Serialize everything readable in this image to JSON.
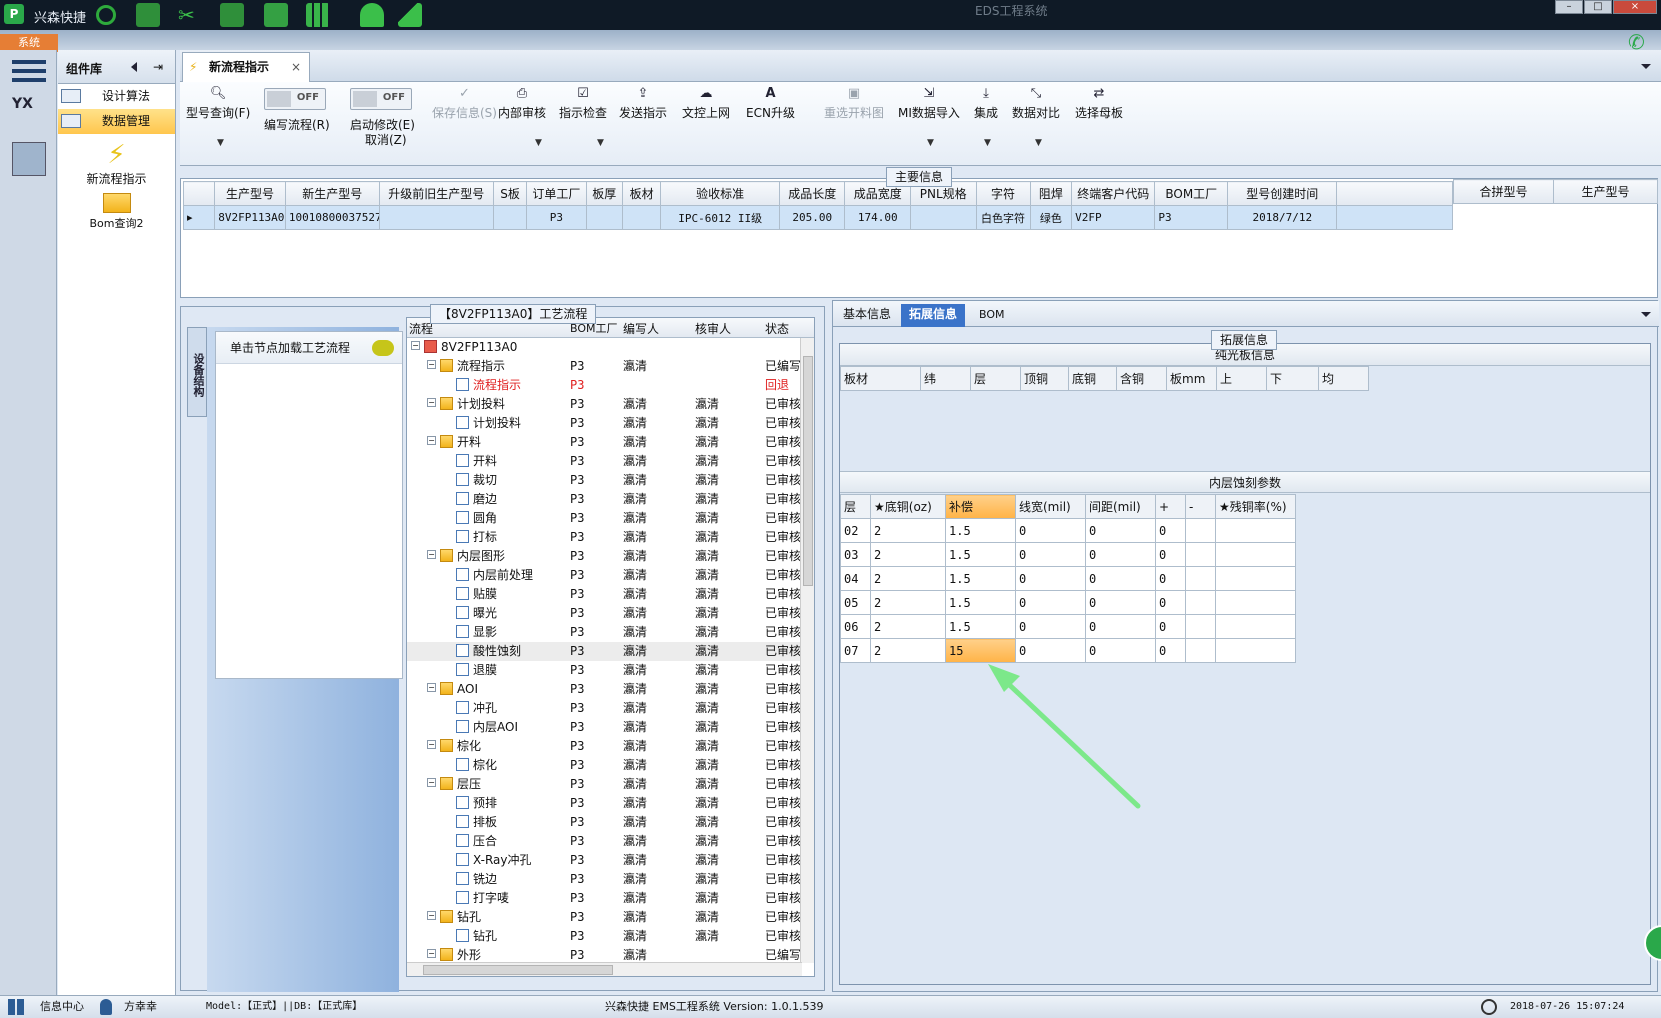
{
  "titlebar": {
    "app_name": "兴森快捷",
    "window_title": "EDS工程系统"
  },
  "system_tab": "系统",
  "component_panel": {
    "title": "组件库",
    "items": [
      {
        "label": "设计算法"
      },
      {
        "label": "数据管理"
      }
    ],
    "big_items": [
      {
        "label": "新流程指示"
      },
      {
        "label": "Bom查询2"
      }
    ]
  },
  "doc_tab": {
    "label": "新流程指示",
    "close": "×"
  },
  "toolbar": {
    "model_query": "型号查询(F)",
    "edit_flow": "编写流程(R)",
    "start_edit": "启动修改(E)",
    "cancel": "取消(Z)",
    "toggle_off": "OFF",
    "save_info": "保存信息(S)",
    "internal_review": "内部审核",
    "instruction_check": "指示检查",
    "send_instruction": "发送指示",
    "upload": "文控上网",
    "ecn_upgrade": "ECN升级",
    "reselect_cut": "重选开料图",
    "mi_import": "MI数据导入",
    "integrate": "集成",
    "data_compare": "数据对比",
    "select_master": "选择母板"
  },
  "main_info": {
    "title": "主要信息",
    "columns": [
      "生产型号",
      "新生产型号",
      "升级前旧生产型号",
      "S板",
      "订单工厂",
      "板厚",
      "板材",
      "验收标准",
      "成品长度",
      "成品宽度",
      "PNL规格",
      "字符",
      "阻焊",
      "终端客户代码",
      "BOM工厂",
      "型号创建时间"
    ],
    "row": [
      "8V2FP113A0",
      "10010800037527",
      "",
      "",
      "P3",
      "",
      "",
      "IPC-6012 II级",
      "205.00",
      "174.00",
      "",
      "白色字符",
      "绿色",
      "V2FP",
      "P3",
      "2018/7/12"
    ],
    "side_columns": [
      "合拼型号",
      "生产型号"
    ]
  },
  "flow_panel": {
    "title": "【8V2FP113A0】工艺流程",
    "vertical_tab": "设备结构",
    "leaf_prompt": "单击节点加载工艺流程",
    "columns": [
      "流程",
      "BOM工厂",
      "编写人",
      "核审人",
      "状态"
    ],
    "rows": [
      {
        "level": 0,
        "type": "home",
        "exp": "−",
        "name": "8V2FP113A0",
        "bom": "",
        "writer": "",
        "reviewer": "",
        "status": ""
      },
      {
        "level": 1,
        "type": "folder",
        "exp": "−",
        "name": "流程指示",
        "bom": "P3",
        "writer": "瀛清",
        "reviewer": "",
        "status": "已编写"
      },
      {
        "level": 2,
        "type": "doc",
        "name": "流程指示",
        "bom": "P3",
        "writer": "",
        "reviewer": "",
        "status": "回退",
        "red": true
      },
      {
        "level": 1,
        "type": "folder",
        "exp": "−",
        "name": "计划投料",
        "bom": "P3",
        "writer": "瀛清",
        "reviewer": "瀛清",
        "status": "已审核"
      },
      {
        "level": 2,
        "type": "doc",
        "name": "计划投料",
        "bom": "P3",
        "writer": "瀛清",
        "reviewer": "瀛清",
        "status": "已审核"
      },
      {
        "level": 1,
        "type": "folder",
        "exp": "−",
        "name": "开料",
        "bom": "P3",
        "writer": "瀛清",
        "reviewer": "瀛清",
        "status": "已审核"
      },
      {
        "level": 2,
        "type": "doc",
        "name": "开料",
        "bom": "P3",
        "writer": "瀛清",
        "reviewer": "瀛清",
        "status": "已审核"
      },
      {
        "level": 2,
        "type": "doc",
        "name": "裁切",
        "bom": "P3",
        "writer": "瀛清",
        "reviewer": "瀛清",
        "status": "已审核"
      },
      {
        "level": 2,
        "type": "doc",
        "name": "磨边",
        "bom": "P3",
        "writer": "瀛清",
        "reviewer": "瀛清",
        "status": "已审核"
      },
      {
        "level": 2,
        "type": "doc",
        "name": "圆角",
        "bom": "P3",
        "writer": "瀛清",
        "reviewer": "瀛清",
        "status": "已审核"
      },
      {
        "level": 2,
        "type": "doc",
        "name": "打标",
        "bom": "P3",
        "writer": "瀛清",
        "reviewer": "瀛清",
        "status": "已审核"
      },
      {
        "level": 1,
        "type": "folder",
        "exp": "−",
        "name": "内层图形",
        "bom": "P3",
        "writer": "瀛清",
        "reviewer": "瀛清",
        "status": "已审核"
      },
      {
        "level": 2,
        "type": "doc",
        "name": "内层前处理",
        "bom": "P3",
        "writer": "瀛清",
        "reviewer": "瀛清",
        "status": "已审核"
      },
      {
        "level": 2,
        "type": "doc",
        "name": "贴膜",
        "bom": "P3",
        "writer": "瀛清",
        "reviewer": "瀛清",
        "status": "已审核"
      },
      {
        "level": 2,
        "type": "doc",
        "name": "曝光",
        "bom": "P3",
        "writer": "瀛清",
        "reviewer": "瀛清",
        "status": "已审核"
      },
      {
        "level": 2,
        "type": "doc",
        "name": "显影",
        "bom": "P3",
        "writer": "瀛清",
        "reviewer": "瀛清",
        "status": "已审核"
      },
      {
        "level": 2,
        "type": "doc",
        "name": "酸性蚀刻",
        "bom": "P3",
        "writer": "瀛清",
        "reviewer": "瀛清",
        "status": "已审核",
        "selected": true
      },
      {
        "level": 2,
        "type": "doc",
        "name": "退膜",
        "bom": "P3",
        "writer": "瀛清",
        "reviewer": "瀛清",
        "status": "已审核"
      },
      {
        "level": 1,
        "type": "folder",
        "exp": "−",
        "name": "AOI",
        "bom": "P3",
        "writer": "瀛清",
        "reviewer": "瀛清",
        "status": "已审核"
      },
      {
        "level": 2,
        "type": "doc",
        "name": "冲孔",
        "bom": "P3",
        "writer": "瀛清",
        "reviewer": "瀛清",
        "status": "已审核"
      },
      {
        "level": 2,
        "type": "doc",
        "name": "内层AOI",
        "bom": "P3",
        "writer": "瀛清",
        "reviewer": "瀛清",
        "status": "已审核"
      },
      {
        "level": 1,
        "type": "folder",
        "exp": "−",
        "name": "棕化",
        "bom": "P3",
        "writer": "瀛清",
        "reviewer": "瀛清",
        "status": "已审核"
      },
      {
        "level": 2,
        "type": "doc",
        "name": "棕化",
        "bom": "P3",
        "writer": "瀛清",
        "reviewer": "瀛清",
        "status": "已审核"
      },
      {
        "level": 1,
        "type": "folder",
        "exp": "−",
        "name": "层压",
        "bom": "P3",
        "writer": "瀛清",
        "reviewer": "瀛清",
        "status": "已审核"
      },
      {
        "level": 2,
        "type": "doc",
        "name": "预排",
        "bom": "P3",
        "writer": "瀛清",
        "reviewer": "瀛清",
        "status": "已审核"
      },
      {
        "level": 2,
        "type": "doc",
        "name": "排板",
        "bom": "P3",
        "writer": "瀛清",
        "reviewer": "瀛清",
        "status": "已审核"
      },
      {
        "level": 2,
        "type": "doc",
        "name": "压合",
        "bom": "P3",
        "writer": "瀛清",
        "reviewer": "瀛清",
        "status": "已审核"
      },
      {
        "level": 2,
        "type": "doc",
        "name": "X-Ray冲孔",
        "bom": "P3",
        "writer": "瀛清",
        "reviewer": "瀛清",
        "status": "已审核"
      },
      {
        "level": 2,
        "type": "doc",
        "name": "铣边",
        "bom": "P3",
        "writer": "瀛清",
        "reviewer": "瀛清",
        "status": "已审核"
      },
      {
        "level": 2,
        "type": "doc",
        "name": "打字唛",
        "bom": "P3",
        "writer": "瀛清",
        "reviewer": "瀛清",
        "status": "已审核"
      },
      {
        "level": 1,
        "type": "folder",
        "exp": "−",
        "name": "钻孔",
        "bom": "P3",
        "writer": "瀛清",
        "reviewer": "瀛清",
        "status": "已审核"
      },
      {
        "level": 2,
        "type": "doc",
        "name": "钻孔",
        "bom": "P3",
        "writer": "瀛清",
        "reviewer": "瀛清",
        "status": "已审核"
      },
      {
        "level": 1,
        "type": "folder",
        "exp": "−",
        "name": "外形",
        "bom": "P3",
        "writer": "瀛清",
        "reviewer": "",
        "status": "已编写"
      }
    ]
  },
  "right_tabs": {
    "tabs": [
      "基本信息",
      "拓展信息",
      "BOM"
    ],
    "title": "拓展信息"
  },
  "bare_board": {
    "title": "纯光板信息",
    "columns": [
      "板材",
      "纬",
      "层",
      "顶铜",
      "底铜",
      "含铜",
      "板mm",
      "上",
      "下",
      "均"
    ]
  },
  "inner_etch": {
    "title": "内层蚀刻参数",
    "columns": [
      "层",
      "★底铜(oz)",
      "补偿",
      "线宽(mil)",
      "间距(mil)",
      "+",
      "-",
      "★残铜率(%)"
    ],
    "rows": [
      [
        "02",
        "2",
        "1.5",
        "0",
        "0",
        "0",
        "",
        ""
      ],
      [
        "03",
        "2",
        "1.5",
        "0",
        "0",
        "0",
        "",
        ""
      ],
      [
        "04",
        "2",
        "1.5",
        "0",
        "0",
        "0",
        "",
        ""
      ],
      [
        "05",
        "2",
        "1.5",
        "0",
        "0",
        "0",
        "",
        ""
      ],
      [
        "06",
        "2",
        "1.5",
        "0",
        "0",
        "0",
        "",
        ""
      ],
      [
        "07",
        "2",
        "15",
        "0",
        "0",
        "0",
        "",
        ""
      ]
    ]
  },
  "statusbar": {
    "info_center": "信息中心",
    "user": "方幸幸",
    "model_db": "Model:【正式】||DB:【正式库】",
    "version": "兴森快捷 EMS工程系统 Version: 1.0.1.539",
    "datetime": "2018-07-26 15:07:24"
  },
  "colors": {
    "accent": "#3a73c9",
    "highlight": "#ffc64d",
    "annotation_arrow": "#7ce88a"
  }
}
